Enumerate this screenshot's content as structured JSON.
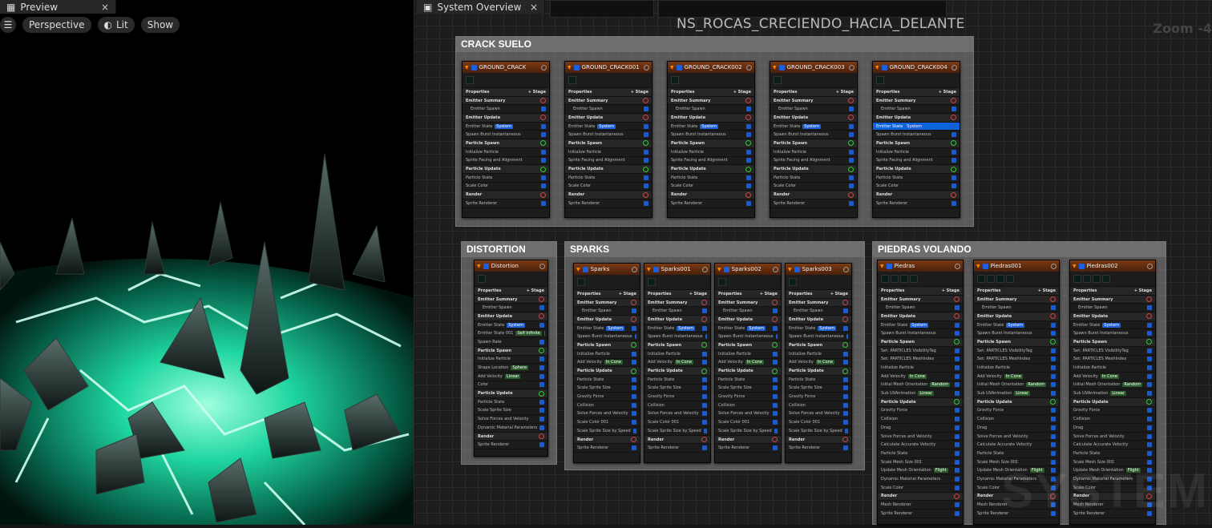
{
  "preview": {
    "tab": "Preview",
    "close": "×",
    "toolbar": {
      "perspective": "Perspective",
      "lit": "Lit",
      "show": "Show"
    }
  },
  "graph": {
    "tab": "System Overview",
    "close": "×",
    "system_name": "NS_ROCAS_CRECIENDO_HACIA_DELANTE",
    "zoom": "Zoom -4",
    "watermark": "SYSTEM"
  },
  "groups": {
    "crack": "CRACK SUELO",
    "distortion": "DISTORTION",
    "sparks": "SPARKS",
    "piedras": "PIEDRAS VOLANDO"
  },
  "crack_nodes": [
    "GROUND_CRACK",
    "GROUND_CRACK001",
    "GROUND_CRACK002",
    "GROUND_CRACK003",
    "GROUND_CRACK004"
  ],
  "crack_rows": [
    [
      "Properties",
      "",
      "sec2"
    ],
    [
      "Emitter Summary",
      "",
      "sec"
    ],
    [
      "Emitter Spawn",
      "",
      "ind"
    ],
    [
      "Emitter Update",
      "",
      "sec"
    ],
    [
      "Emitter State",
      "System",
      "r"
    ],
    [
      "Spawn Burst Instantaneous",
      "",
      "r"
    ],
    [
      "Particle Spawn",
      "",
      "sec"
    ],
    [
      "Initialize Particle",
      "",
      "r"
    ],
    [
      "Sprite Facing and Alignment",
      "",
      "r"
    ],
    [
      "Particle Update",
      "",
      "sec"
    ],
    [
      "Particle State",
      "",
      "r"
    ],
    [
      "Scale Color",
      "",
      "r"
    ],
    [
      "Render",
      "",
      "sec"
    ],
    [
      "Sprite Renderer",
      "",
      "r"
    ]
  ],
  "distortion_node": "Distortion",
  "distortion_rows": [
    [
      "Properties",
      "",
      "sec2"
    ],
    [
      "Emitter Summary",
      "",
      "sec"
    ],
    [
      "Emitter Spawn",
      "",
      "ind"
    ],
    [
      "Emitter Update",
      "",
      "sec"
    ],
    [
      "Emitter State",
      "System",
      "r"
    ],
    [
      "Emitter State 001",
      "Self  Infinite",
      "r"
    ],
    [
      "Spawn Rate",
      "",
      "r"
    ],
    [
      "Particle Spawn",
      "",
      "sec"
    ],
    [
      "Initialize Particle",
      "",
      "r"
    ],
    [
      "Shape Location",
      "Sphere",
      "r"
    ],
    [
      "Add Velocity",
      "Linear",
      "r"
    ],
    [
      "Color",
      "",
      "r"
    ],
    [
      "Particle Update",
      "",
      "sec"
    ],
    [
      "Particle State",
      "",
      "r"
    ],
    [
      "Scale Sprite Size",
      "",
      "r"
    ],
    [
      "Solve Forces and Velocity",
      "",
      "r"
    ],
    [
      "Dynamic Material Parameters",
      "",
      "r"
    ],
    [
      "Render",
      "",
      "sec"
    ],
    [
      "Sprite Renderer",
      "",
      "r"
    ]
  ],
  "spark_nodes": [
    "Sparks",
    "Sparks001",
    "Sparks002",
    "Sparks003"
  ],
  "spark_rows": [
    [
      "Properties",
      "",
      "sec2"
    ],
    [
      "Emitter Summary",
      "",
      "sec"
    ],
    [
      "Emitter Spawn",
      "",
      "ind"
    ],
    [
      "Emitter Update",
      "",
      "sec"
    ],
    [
      "Emitter State",
      "System",
      "r"
    ],
    [
      "Spawn Burst Instantaneous",
      "",
      "r"
    ],
    [
      "Particle Spawn",
      "",
      "sec"
    ],
    [
      "Initialize Particle",
      "",
      "r"
    ],
    [
      "Add Velocity",
      "In Cone",
      "r"
    ],
    [
      "Particle Update",
      "",
      "sec"
    ],
    [
      "Particle State",
      "",
      "r"
    ],
    [
      "Scale Sprite Size",
      "",
      "r"
    ],
    [
      "Gravity Force",
      "",
      "r"
    ],
    [
      "Collision",
      "",
      "r"
    ],
    [
      "Solve Forces and Velocity",
      "",
      "r"
    ],
    [
      "Scale Color 001",
      "",
      "r"
    ],
    [
      "Scale Sprite Size by Speed",
      "",
      "r"
    ],
    [
      "Render",
      "",
      "sec"
    ],
    [
      "Sprite Renderer",
      "",
      "r"
    ]
  ],
  "piedra_nodes": [
    "Piedras",
    "Piedras001",
    "Piedras002"
  ],
  "piedra_rows": [
    [
      "Properties",
      "",
      "sec2"
    ],
    [
      "Emitter Summary",
      "",
      "sec"
    ],
    [
      "Emitter Spawn",
      "",
      "ind"
    ],
    [
      "Emitter Update",
      "",
      "sec"
    ],
    [
      "Emitter State",
      "System",
      "r"
    ],
    [
      "Spawn Burst Instantaneous",
      "",
      "r"
    ],
    [
      "Particle Spawn",
      "",
      "sec"
    ],
    [
      "Set: PARTICLES VisibilityTag",
      "",
      "r"
    ],
    [
      "Set: PARTICLES MeshIndex",
      "",
      "r"
    ],
    [
      "Initialize Particle",
      "",
      "r"
    ],
    [
      "Add Velocity",
      "In Cone",
      "r"
    ],
    [
      "Initial Mesh Orientation",
      "Random",
      "r"
    ],
    [
      "Sub UVAnimation",
      "Linear",
      "r"
    ],
    [
      "Particle Update",
      "",
      "sec"
    ],
    [
      "Gravity Force",
      "",
      "r"
    ],
    [
      "Collision",
      "",
      "r"
    ],
    [
      "Drag",
      "",
      "r"
    ],
    [
      "Solve Forces and Velocity",
      "",
      "r"
    ],
    [
      "Calculate Accurate Velocity",
      "",
      "r"
    ],
    [
      "Particle State",
      "",
      "r"
    ],
    [
      "Scale Mesh Size 001",
      "",
      "r"
    ],
    [
      "Update Mesh Orientation",
      "Flight",
      "r"
    ],
    [
      "Dynamic Material Parameters",
      "",
      "r"
    ],
    [
      "Scale Color",
      "",
      "r"
    ],
    [
      "Render",
      "",
      "sec"
    ],
    [
      "Mesh Renderer",
      "",
      "r"
    ],
    [
      "Sprite Renderer",
      "",
      "r"
    ]
  ],
  "stage_label": "+ Stage"
}
